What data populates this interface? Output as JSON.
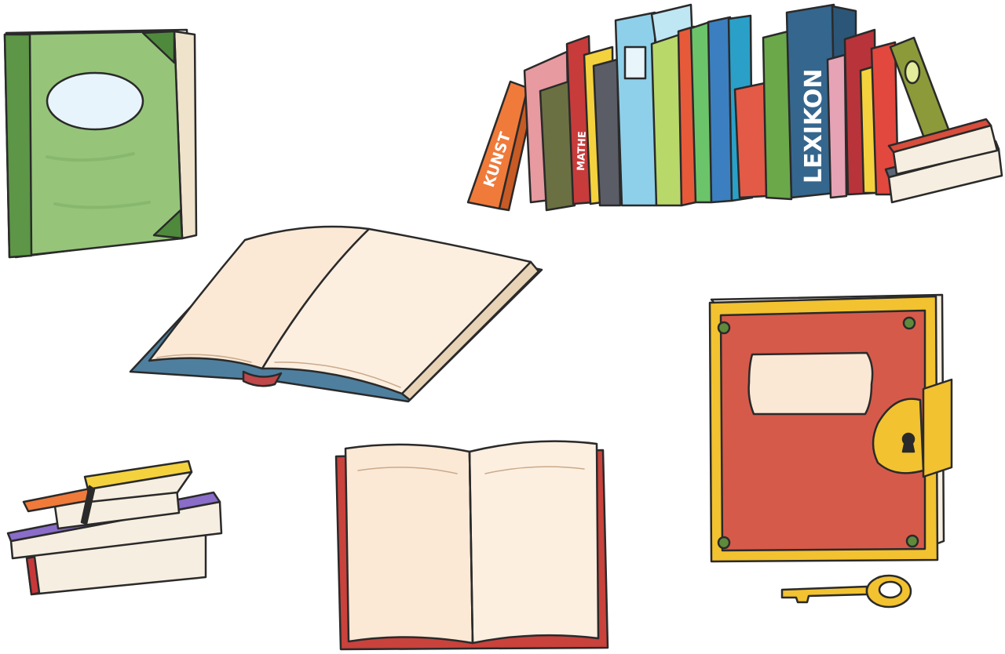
{
  "illustration": {
    "spine_labels": {
      "kunst": "KUNST",
      "mathe": "MATHE",
      "lexikon": "LEXIKON"
    },
    "colors": {
      "outline": "#2a2a2a",
      "green_cover": "#8fbf6f",
      "green_dark": "#4f8a3c",
      "page": "#fbe9d6",
      "page_edge": "#e9d3b6",
      "blue_cover": "#4f7f9e",
      "red_cover": "#d65a4a",
      "gold": "#f2c230",
      "orange": "#f07a3a",
      "purple": "#8a6cc9",
      "yellow": "#f4d23e"
    }
  }
}
